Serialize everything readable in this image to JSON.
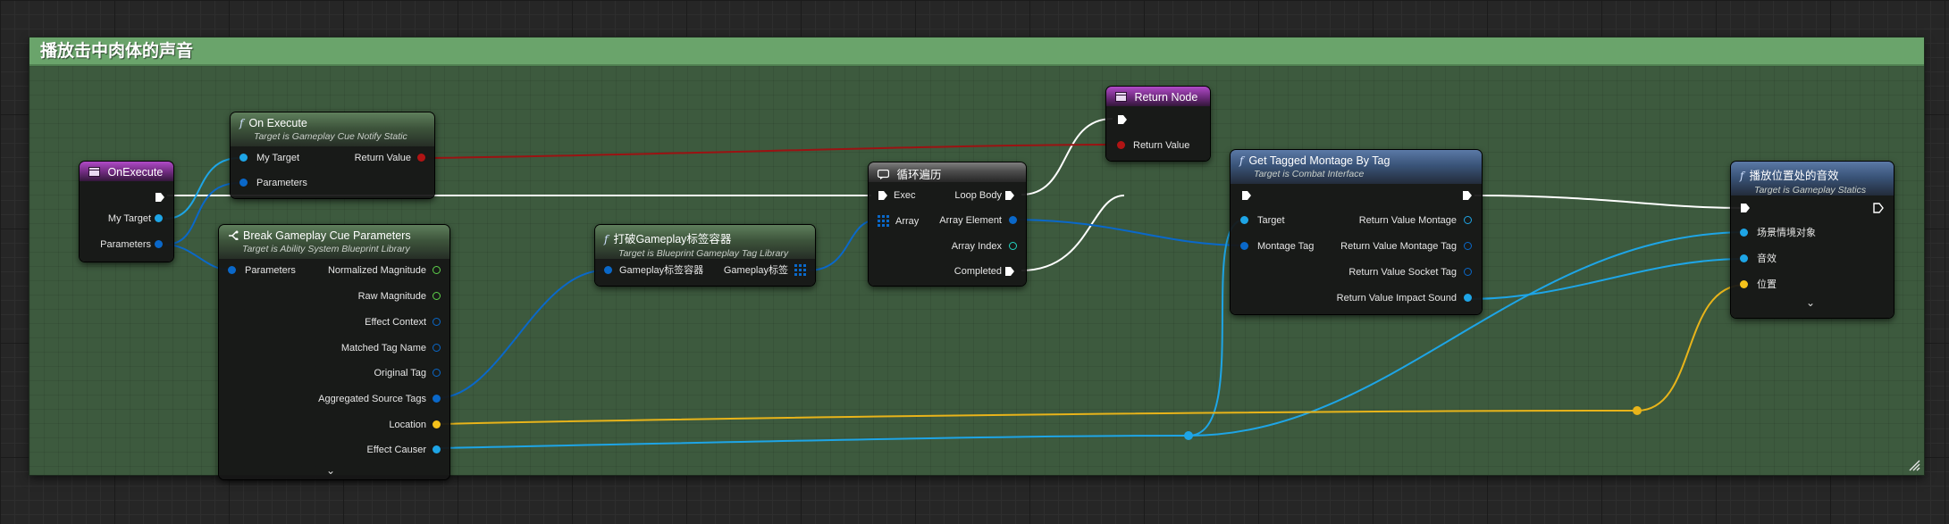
{
  "comment": {
    "title": "播放击中肉体的声音"
  },
  "colors": {
    "exec": "#ffffff",
    "struct": "#0a68c9",
    "object": "#1ea5e6",
    "vector": "#f5c21b",
    "float_green": "#5ed24a",
    "int_teal": "#22d6c2",
    "return_red": "#b01414",
    "comment_bg": "#3d5a3e",
    "comment_header": "#6aa46b"
  },
  "nodes": {
    "on_execute_event": {
      "title": "OnExecute",
      "pins": {
        "my_target": "My Target",
        "parameters": "Parameters"
      }
    },
    "on_execute": {
      "title": "On Execute",
      "subtitle": "Target is Gameplay Cue Notify Static",
      "pins": {
        "my_target": "My Target",
        "return_value": "Return Value",
        "parameters": "Parameters"
      }
    },
    "break_params": {
      "title": "Break Gameplay Cue Parameters",
      "subtitle": "Target is Ability System Blueprint Library",
      "pins": {
        "parameters": "Parameters",
        "normalized_magnitude": "Normalized Magnitude",
        "raw_magnitude": "Raw Magnitude",
        "effect_context": "Effect Context",
        "matched_tag_name": "Matched Tag Name",
        "original_tag": "Original Tag",
        "aggregated_source_tags": "Aggregated Source Tags",
        "location": "Location",
        "effect_causer": "Effect Causer"
      }
    },
    "break_container": {
      "title": "打破Gameplay标签容器",
      "subtitle": "Target is Blueprint Gameplay Tag Library",
      "pins": {
        "input": "Gameplay标签容器",
        "output": "Gameplay标签"
      }
    },
    "for_each": {
      "title": "循环遍历",
      "pins": {
        "exec": "Exec",
        "array": "Array",
        "loop_body": "Loop Body",
        "array_element": "Array Element",
        "array_index": "Array Index",
        "completed": "Completed"
      }
    },
    "return_node": {
      "title": "Return Node",
      "pins": {
        "return_value": "Return Value"
      }
    },
    "get_montage": {
      "title": "Get Tagged Montage By Tag",
      "subtitle": "Target is Combat Interface",
      "pins": {
        "target": "Target",
        "montage_tag": "Montage Tag",
        "rv_montage": "Return Value Montage",
        "rv_montage_tag": "Return Value Montage Tag",
        "rv_socket_tag": "Return Value Socket Tag",
        "rv_impact_sound": "Return Value Impact Sound"
      }
    },
    "play_sound": {
      "title": "播放位置处的音效",
      "subtitle": "Target is Gameplay Statics",
      "pins": {
        "world_context": "场景情境对象",
        "sound": "音效",
        "location": "位置"
      }
    }
  }
}
